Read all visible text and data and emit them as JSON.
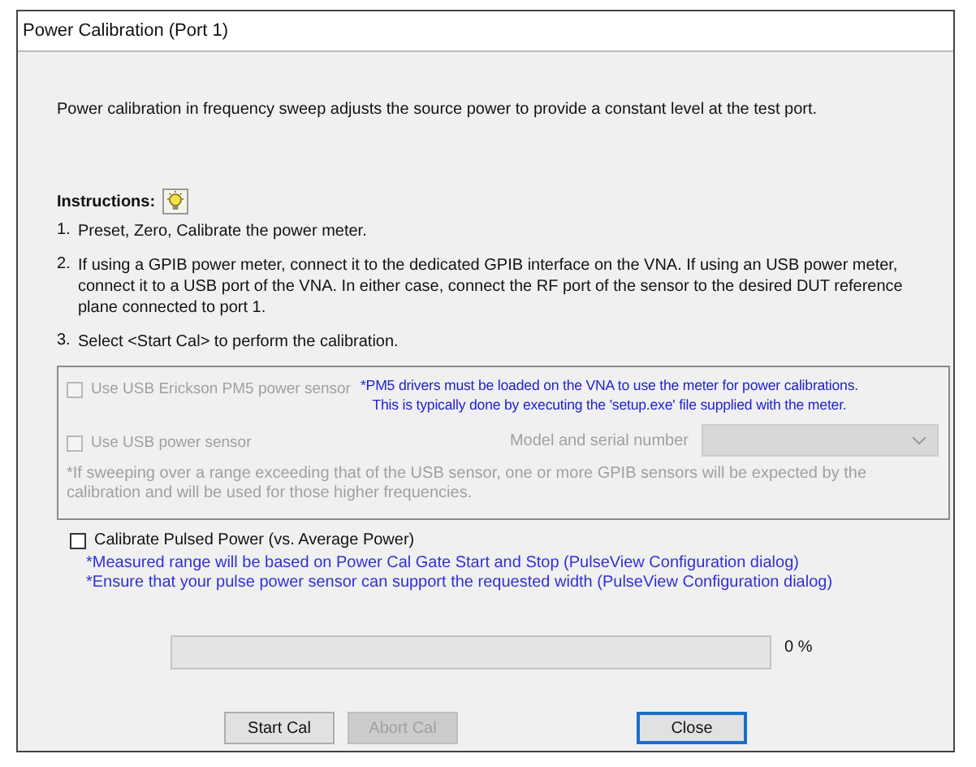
{
  "window": {
    "title": "Power Calibration (Port 1)"
  },
  "intro": "Power calibration in frequency sweep adjusts the source power to provide a constant level at the test port.",
  "instructions": {
    "label": "Instructions:",
    "steps": [
      {
        "number": "1.",
        "text": "Preset, Zero, Calibrate the power meter."
      },
      {
        "number": "2.",
        "text": "If using a GPIB power meter, connect it to the dedicated GPIB interface on the VNA.  If using an USB power meter, connect it to a USB port of the VNA.  In either case, connect the RF port of the sensor to the desired DUT reference plane connected to port 1."
      },
      {
        "number": "3.",
        "text": "Select <Start Cal> to perform the calibration."
      }
    ]
  },
  "sensor_group": {
    "pm5": {
      "label": "Use USB Erickson PM5 power sensor",
      "checked": false,
      "disabled": true,
      "note": [
        "*PM5 drivers must be loaded on the VNA to use the meter for power calibrations.",
        "This is typically done by executing the 'setup.exe' file supplied with the meter."
      ]
    },
    "usb": {
      "label": "Use USB power sensor",
      "checked": false,
      "disabled": true
    },
    "model": {
      "label": "Model and serial number",
      "disabled": true
    },
    "footnote": "*If sweeping over a range exceeding that of the USB sensor, one or more GPIB sensors will be expected by the calibration and will be used for those higher frequencies."
  },
  "pulsed": {
    "label": "Calibrate Pulsed Power (vs. Average Power)",
    "checked": false,
    "notes": [
      "*Measured range will be based on Power Cal Gate Start and Stop (PulseView Configuration dialog)",
      "*Ensure that your pulse power sensor can support the requested width (PulseView Configuration dialog)"
    ]
  },
  "progress": {
    "level": 0,
    "reading": "0 %"
  },
  "buttons": [
    {
      "label": "Start Cal",
      "disabled": false,
      "default": false
    },
    {
      "label": "Abort Cal",
      "disabled": true,
      "default": false
    },
    {
      "label": "Close",
      "disabled": false,
      "default": true
    }
  ]
}
